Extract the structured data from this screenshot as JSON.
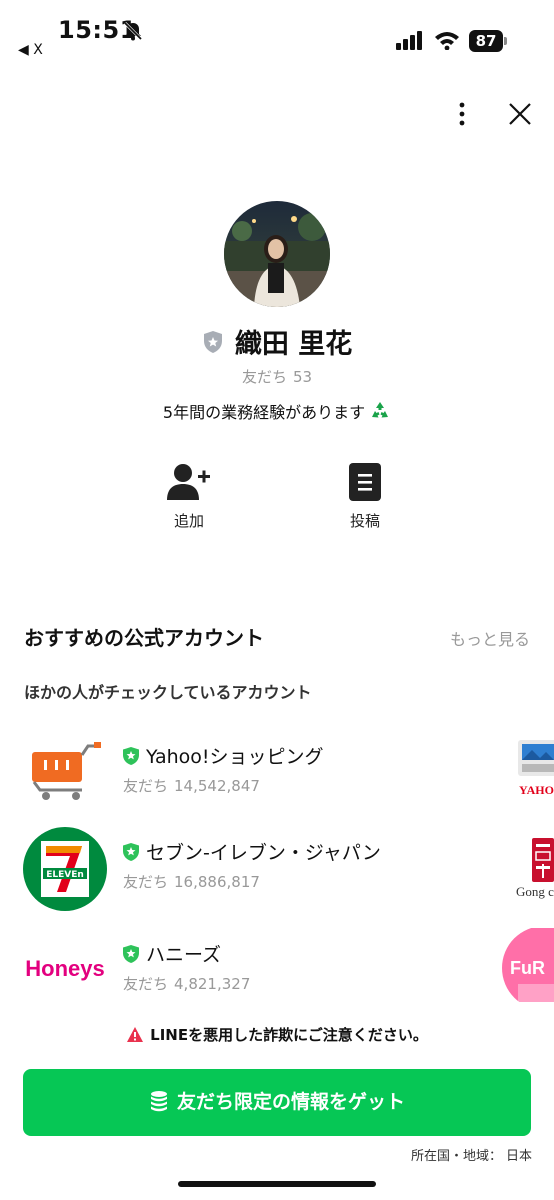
{
  "status_bar": {
    "time": "15:51",
    "back_app": "◀ X",
    "battery": "87"
  },
  "profile": {
    "name": "織田 里花",
    "friends_label": "友だち",
    "friends_count": "53",
    "status_message": "5年間の業務経験があります"
  },
  "actions": {
    "add_label": "追加",
    "post_label": "投稿"
  },
  "recommendations": {
    "title": "おすすめの公式アカウント",
    "more_label": "もっと見る",
    "subtitle": "ほかの人がチェックしているアカウント",
    "accounts": [
      {
        "name": "Yahoo!ショッピング",
        "friends_label": "友だち",
        "friends_count": "14,542,847",
        "side_text": "YAHO"
      },
      {
        "name": "セブン-イレブン・ジャパン",
        "friends_label": "友だち",
        "friends_count": "16,886,817",
        "logo_text": "ELEVEn",
        "side_text": "Gong c"
      },
      {
        "name": "ハニーズ",
        "friends_label": "友だち",
        "friends_count": "4,821,327",
        "logo_text": "Honeys",
        "side_text": "FuR"
      }
    ]
  },
  "warning": "LINEを悪用した詐欺にご注意ください。",
  "cta_label": "友だち限定の情報をゲット",
  "region": {
    "label": "所在国・地域：",
    "value": "日本"
  },
  "colors": {
    "line_green": "#06c755",
    "seven_green": "#008a3e",
    "seven_orange": "#f18b00",
    "seven_red": "#e2001a",
    "honeys_pink": "#e3007f",
    "yahoo_orange": "#f06b22",
    "warning_red": "#e9324e"
  }
}
